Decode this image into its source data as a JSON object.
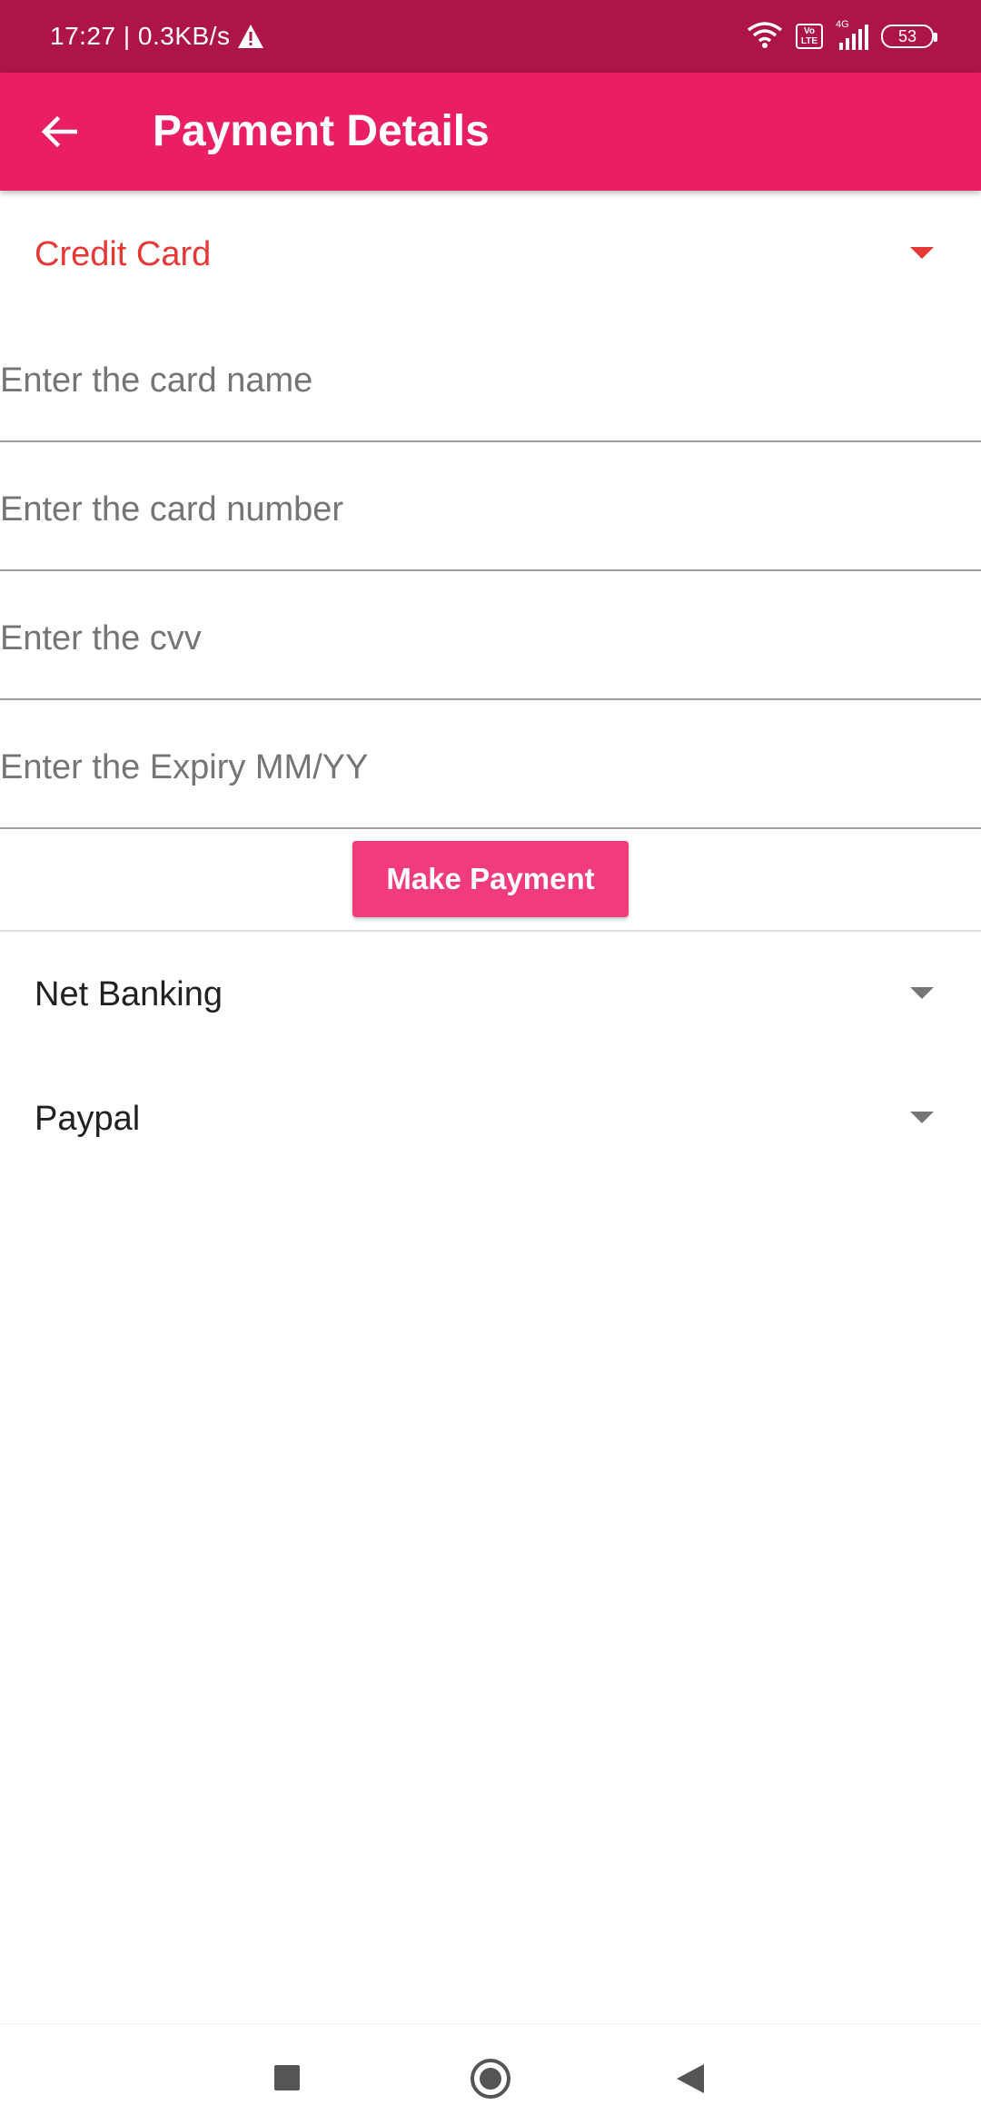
{
  "status_bar": {
    "time_speed": "17:27 | 0.3KB/s",
    "volte": "Vo LTE",
    "network": "4G",
    "battery": "53",
    "icons": [
      "warning-icon",
      "wifi-icon",
      "volte-icon",
      "signal-icon",
      "battery-icon"
    ]
  },
  "app_bar": {
    "back_icon": "arrow-back-icon",
    "title": "Payment Details",
    "background": "#e91e63"
  },
  "credit_card": {
    "label": "Credit Card",
    "expanded": true,
    "accent": "#e53935",
    "fields": {
      "card_name_placeholder": "Enter the card name",
      "card_number_placeholder": "Enter the card number",
      "cvv_placeholder": "Enter the cvv",
      "expiry_placeholder": "Enter the Expiry MM/YY"
    },
    "button_label": "Make Payment"
  },
  "net_banking": {
    "label": "Net Banking",
    "expanded": false
  },
  "paypal": {
    "label": "Paypal",
    "expanded": false
  },
  "nav_bar": {
    "icons": [
      "recents-square-icon",
      "home-circle-icon",
      "back-triangle-icon"
    ]
  }
}
